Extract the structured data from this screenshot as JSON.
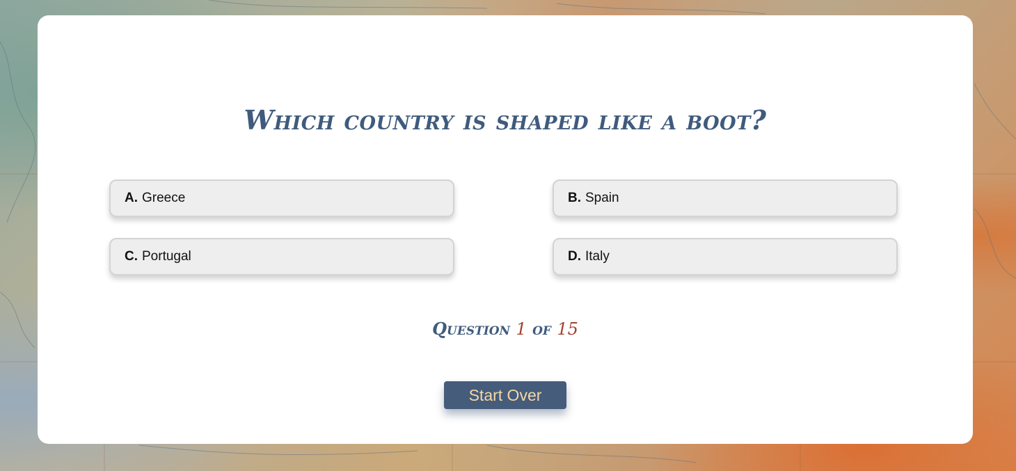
{
  "quiz": {
    "question": "Which country is shaped like a boot?",
    "answers": [
      {
        "letter": "A.",
        "text": "Greece"
      },
      {
        "letter": "B.",
        "text": "Spain"
      },
      {
        "letter": "C.",
        "text": "Portugal"
      },
      {
        "letter": "D.",
        "text": "Italy"
      }
    ],
    "progress": {
      "prefix": "Question",
      "current": "1",
      "separator": "of",
      "total": "15"
    },
    "start_over_label": "Start Over"
  },
  "colors": {
    "title": "#3f5b7d",
    "progress_number": "#a3412e",
    "button_bg": "#455c7b",
    "button_text": "#f5d7a6",
    "answer_bg": "#eeeeee"
  }
}
